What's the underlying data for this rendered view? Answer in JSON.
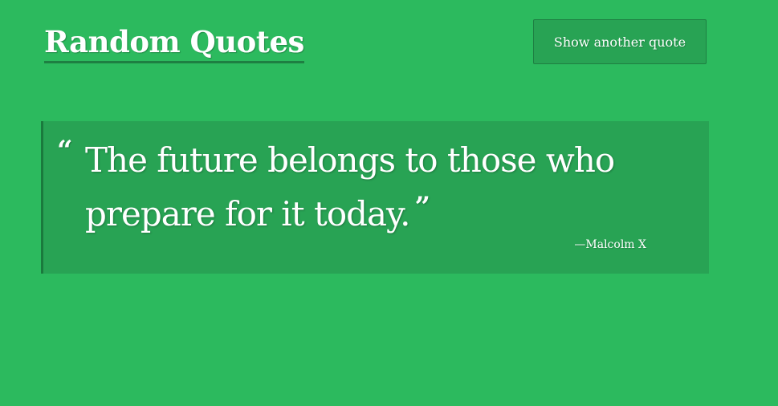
{
  "header": {
    "title": "Random Quotes",
    "new_quote_label": "Show another quote"
  },
  "quote": {
    "open_mark": "“",
    "text": "The future belongs to those who prepare for it today.",
    "close_mark": "”",
    "author": "—Malcolm X"
  },
  "colors": {
    "background": "#2cba5e",
    "card": "#28a354",
    "accent_border": "#1a7a3d",
    "text": "#ffffff"
  }
}
